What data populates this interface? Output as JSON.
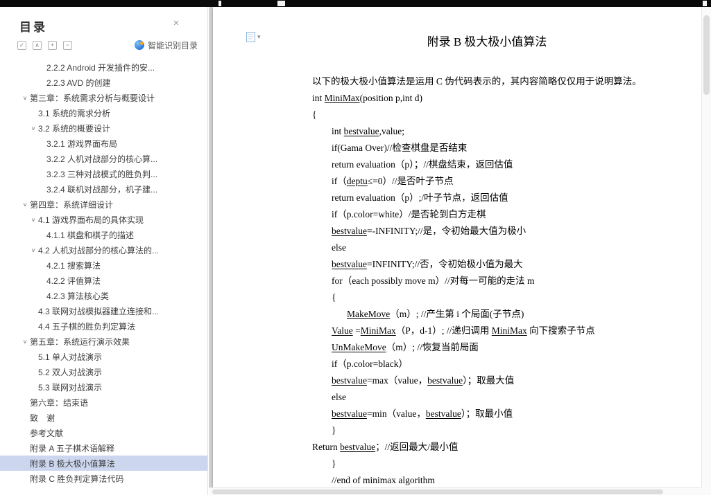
{
  "colors": {
    "selection_bg": "#ccd6ee",
    "smart_icon_blue": "#2f7de1",
    "topbar": "#0a0a0a",
    "canvas_bg": "#d4d4d4",
    "page_bg": "#ffffff"
  },
  "sidebar": {
    "title": "目录",
    "close_glyph": "×",
    "caret_glyph": "∨",
    "toolbar": {
      "icons": [
        {
          "name": "select-all-icon",
          "glyph": "✓"
        },
        {
          "name": "locate-heading-icon",
          "glyph": "∧"
        },
        {
          "name": "expand-all-icon",
          "glyph": "+"
        },
        {
          "name": "collapse-all-icon",
          "glyph": "−"
        }
      ],
      "smart_label": "智能识别目录"
    },
    "items": [
      {
        "label": "2.2.2 Android 开发插件的安...",
        "level": 3,
        "caret": false,
        "selected": false
      },
      {
        "label": "2.2.3 AVD 的创建",
        "level": 3,
        "caret": false,
        "selected": false
      },
      {
        "label": "第三章：系统需求分析与概要设计",
        "level": 1,
        "caret": true,
        "selected": false
      },
      {
        "label": "3.1 系统的需求分析",
        "level": 2,
        "caret": false,
        "selected": false
      },
      {
        "label": "3.2 系统的概要设计",
        "level": 2,
        "caret": true,
        "selected": false
      },
      {
        "label": "3.2.1 游戏界面布局",
        "level": 3,
        "caret": false,
        "selected": false
      },
      {
        "label": "3.2.2 人机对战部分的核心算...",
        "level": 3,
        "caret": false,
        "selected": false
      },
      {
        "label": "3.2.3 三种对战模式的胜负判...",
        "level": 3,
        "caret": false,
        "selected": false
      },
      {
        "label": "3.2.4 联机对战部分，机子建...",
        "level": 3,
        "caret": false,
        "selected": false
      },
      {
        "label": "第四章：系统详细设计",
        "level": 1,
        "caret": true,
        "selected": false
      },
      {
        "label": "4.1 游戏界面布局的具体实现",
        "level": 2,
        "caret": true,
        "selected": false
      },
      {
        "label": "4.1.1 棋盘和棋子的描述",
        "level": 3,
        "caret": false,
        "selected": false
      },
      {
        "label": "4.2 人机对战部分的核心算法的...",
        "level": 2,
        "caret": true,
        "selected": false
      },
      {
        "label": "4.2.1  搜索算法",
        "level": 3,
        "caret": false,
        "selected": false
      },
      {
        "label": "4.2.2  评值算法",
        "level": 3,
        "caret": false,
        "selected": false
      },
      {
        "label": "4.2.3  算法核心类",
        "level": 3,
        "caret": false,
        "selected": false
      },
      {
        "label": "4.3 联网对战模拟器建立连接和...",
        "level": 2,
        "caret": false,
        "selected": false
      },
      {
        "label": "4.4 五子棋的胜负判定算法",
        "level": 2,
        "caret": false,
        "selected": false
      },
      {
        "label": "第五章：系统运行演示效果",
        "level": 1,
        "caret": true,
        "selected": false
      },
      {
        "label": "5.1 单人对战演示",
        "level": 2,
        "caret": false,
        "selected": false
      },
      {
        "label": "5.2 双人对战演示",
        "level": 2,
        "caret": false,
        "selected": false
      },
      {
        "label": "5.3 联网对战演示",
        "level": 2,
        "caret": false,
        "selected": false
      },
      {
        "label": "第六章：结束语",
        "level": 1,
        "caret": false,
        "selected": false
      },
      {
        "label": "致　谢",
        "level": 1,
        "caret": false,
        "selected": false
      },
      {
        "label": "参考文献",
        "level": 1,
        "caret": false,
        "selected": false
      },
      {
        "label": "附录 A 五子棋术语解释",
        "level": 1,
        "caret": false,
        "selected": false
      },
      {
        "label": "附录 B 极大极小值算法",
        "level": 1,
        "caret": false,
        "selected": true
      },
      {
        "label": "附录 C 胜负判定算法代码",
        "level": 1,
        "caret": false,
        "selected": false
      }
    ]
  },
  "document": {
    "title": "附录 B 极大极小值算法",
    "nav_caret_glyph": "▾",
    "lines": [
      {
        "indent": 0,
        "segments": [
          {
            "t": "以下的极大极小值算法是运用 C 伪代码表示的，其内容简略仅仅用于说明算法。"
          }
        ]
      },
      {
        "indent": 0,
        "segments": [
          {
            "t": "int "
          },
          {
            "t": "MiniMax",
            "u": true
          },
          {
            "t": "(position p,int d)"
          }
        ]
      },
      {
        "indent": 0,
        "segments": [
          {
            "t": "{"
          }
        ]
      },
      {
        "indent": 1,
        "segments": [
          {
            "t": "int "
          },
          {
            "t": "bestvalue",
            "u": true
          },
          {
            "t": ",value;"
          }
        ]
      },
      {
        "indent": 1,
        "segments": [
          {
            "t": "if(Gama Over)//检查棋盘是否结束"
          }
        ]
      },
      {
        "indent": 1,
        "segments": [
          {
            "t": "return evaluation（p）；//棋盘结束，返回估值"
          }
        ]
      },
      {
        "indent": 1,
        "segments": [
          {
            "t": "if（"
          },
          {
            "t": "deptu",
            "u": true
          },
          {
            "t": "≤=0）//是否叶子节点"
          }
        ]
      },
      {
        "indent": 1,
        "segments": [
          {
            "t": "return evaluation（p）;/叶子节点，返回估值"
          }
        ]
      },
      {
        "indent": 1,
        "segments": [
          {
            "t": "if（p.color=white）/是否轮到白方走棋"
          }
        ]
      },
      {
        "indent": 1,
        "segments": [
          {
            "t": "bestvalue",
            "u": true
          },
          {
            "t": "=-INFINITY;//是，令初始最大值为极小"
          }
        ]
      },
      {
        "indent": 1,
        "segments": [
          {
            "t": "else"
          }
        ]
      },
      {
        "indent": 1,
        "segments": [
          {
            "t": "bestvalue",
            "u": true
          },
          {
            "t": "=INFINITY;//否，令初始极小值为最大"
          }
        ]
      },
      {
        "indent": 1,
        "segments": [
          {
            "t": "for（each possibly move m）//对每一可能的走法 m"
          }
        ]
      },
      {
        "indent": 1,
        "segments": [
          {
            "t": "{"
          }
        ]
      },
      {
        "indent": 2,
        "segments": [
          {
            "t": "MakeMove",
            "u": true
          },
          {
            "t": "（m）; //产生第 i 个局面(子节点)"
          }
        ]
      },
      {
        "indent": 1,
        "segments": [
          {
            "t": "Value",
            "u": true
          },
          {
            "t": " ="
          },
          {
            "t": "MiniMax",
            "u": true
          },
          {
            "t": "（P，d-1）; //递归调用 "
          },
          {
            "t": "MiniMax",
            "u": true
          },
          {
            "t": " 向下搜索子节点"
          }
        ]
      },
      {
        "indent": 1,
        "segments": [
          {
            "t": "UnMakeMove",
            "u": true
          },
          {
            "t": "（m）; //恢复当前局面"
          }
        ]
      },
      {
        "indent": 1,
        "segments": [
          {
            "t": "if（p.color=black）"
          }
        ]
      },
      {
        "indent": 1,
        "segments": [
          {
            "t": "bestvalue",
            "u": true
          },
          {
            "t": "=max（value，"
          },
          {
            "t": "bestvalue",
            "u": true
          },
          {
            "t": "）；取最大值"
          }
        ]
      },
      {
        "indent": 1,
        "segments": [
          {
            "t": "else"
          }
        ]
      },
      {
        "indent": 1,
        "segments": [
          {
            "t": "bestvalue",
            "u": true
          },
          {
            "t": "=min（value，"
          },
          {
            "t": "bestvalue",
            "u": true
          },
          {
            "t": "）；取最小值"
          }
        ]
      },
      {
        "indent": 1,
        "segments": [
          {
            "t": "}"
          }
        ]
      },
      {
        "indent": 0,
        "segments": [
          {
            "t": "Return "
          },
          {
            "t": "bestvalue",
            "u": true
          },
          {
            "t": "；//返回最大/最小值"
          }
        ]
      },
      {
        "indent": 1,
        "segments": [
          {
            "t": "}"
          }
        ]
      },
      {
        "indent": 1,
        "segments": [
          {
            "t": "//end of minimax algorithm"
          }
        ]
      }
    ]
  }
}
